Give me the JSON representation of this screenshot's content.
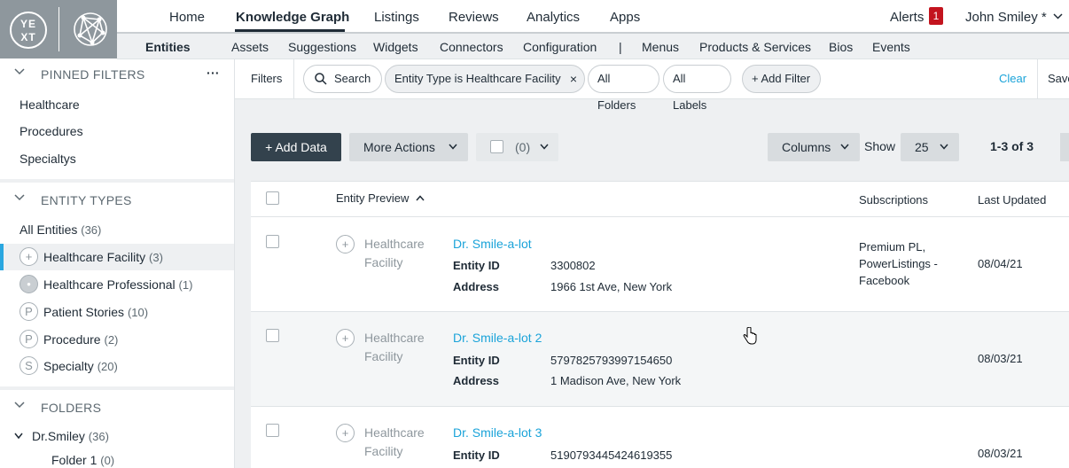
{
  "top_nav": {
    "items": [
      "Home",
      "Knowledge Graph",
      "Listings",
      "Reviews",
      "Analytics",
      "Apps"
    ],
    "alerts_label": "Alerts",
    "alerts_count": "1",
    "user": "John Smiley *"
  },
  "sub_nav": {
    "items": [
      "Entities",
      "Assets",
      "Suggestions",
      "Widgets",
      "Connectors",
      "Configuration",
      "|",
      "Menus",
      "Products & Services",
      "Bios",
      "Events"
    ]
  },
  "logo": {
    "text_top": "YE",
    "text_bottom": "XT"
  },
  "sidebar": {
    "pinned": {
      "title": "PINNED FILTERS",
      "more": "···",
      "items": [
        "Healthcare",
        "Procedures",
        "Specialtys"
      ]
    },
    "entity_types": {
      "title": "ENTITY TYPES",
      "all": {
        "label": "All Entities",
        "count": "(36)"
      },
      "items": [
        {
          "label": "Healthcare Facility",
          "count": "(3)",
          "icon": "+"
        },
        {
          "label": "Healthcare Professional",
          "count": "(1)",
          "icon": "•"
        },
        {
          "label": "Patient Stories",
          "count": "(10)",
          "icon": "P"
        },
        {
          "label": "Procedure",
          "count": "(2)",
          "icon": "P"
        },
        {
          "label": "Specialty",
          "count": "(20)",
          "icon": "S"
        }
      ]
    },
    "folders": {
      "title": "FOLDERS",
      "root": {
        "label": "Dr.Smiley",
        "count": "(36)"
      },
      "child": {
        "label": "Folder 1",
        "count": "(0)"
      }
    }
  },
  "filters": {
    "label": "Filters",
    "search": "Search",
    "entity_type_pill": "Entity Type is Healthcare Facility",
    "folders_pill": "All Folders",
    "labels_pill": "All Labels",
    "add_filter": "+ Add Filter",
    "clear": "Clear",
    "save": "Save"
  },
  "toolbar": {
    "add_data": "+ Add Data",
    "more_actions": "More Actions",
    "selected_count": "(0)",
    "columns": "Columns",
    "show": "Show",
    "page_size": "25",
    "range": "1-3 of 3"
  },
  "table": {
    "headers": {
      "preview": "Entity Preview",
      "subscriptions": "Subscriptions",
      "last_updated": "Last Updated"
    },
    "rows": [
      {
        "type": "Healthcare Facility",
        "name": "Dr. Smile-a-lot",
        "id_label": "Entity ID",
        "id": "3300802",
        "addr_label": "Address",
        "address": "1966 1st Ave, New York",
        "subscriptions": "Premium PL, PowerListings - Facebook",
        "updated": "08/04/21"
      },
      {
        "type": "Healthcare Facility",
        "name": "Dr. Smile-a-lot 2",
        "id_label": "Entity ID",
        "id": "5797825793997154650",
        "addr_label": "Address",
        "address": "1 Madison Ave, New York",
        "subscriptions": "",
        "updated": "08/03/21"
      },
      {
        "type": "Healthcare Facility",
        "name": "Dr. Smile-a-lot 3",
        "id_label": "Entity ID",
        "id": "5190793445424619355",
        "addr_label": "",
        "address": "",
        "subscriptions": "",
        "updated": "08/03/21"
      }
    ]
  },
  "colors": {
    "accent": "#1aa3d9",
    "dark_button": "#33424d",
    "badge": "#c3141e",
    "logo_bg": "#8e979d"
  }
}
